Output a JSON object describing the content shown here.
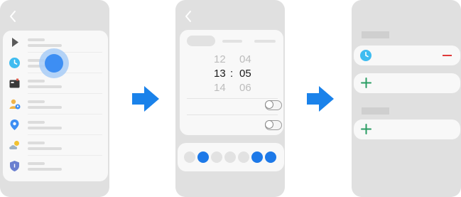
{
  "steps": [
    {
      "name": "settings-list"
    },
    {
      "name": "time-picker"
    },
    {
      "name": "schedule-list"
    }
  ],
  "time_picker": {
    "hours": [
      "12",
      "13",
      "14"
    ],
    "minutes": [
      "04",
      "05",
      "06"
    ],
    "separator": ":",
    "selected_hour": "13",
    "selected_minute": "05"
  },
  "repeat_days": [
    false,
    true,
    false,
    false,
    false,
    true,
    true
  ],
  "colors": {
    "accent_blue": "#1d79e8",
    "arrow_blue": "#1a82ea",
    "minus_red": "#e03a3a",
    "plus_green": "#2a9d63",
    "clock_teal": "#3fbcf0"
  },
  "icons": {
    "settings_list": [
      "play-icon",
      "clock-icon",
      "battery-icon",
      "person-location-icon",
      "location-pin-icon",
      "weather-icon",
      "shield-icon"
    ],
    "arrows": [
      "right-arrow-icon",
      "right-arrow-icon"
    ]
  }
}
